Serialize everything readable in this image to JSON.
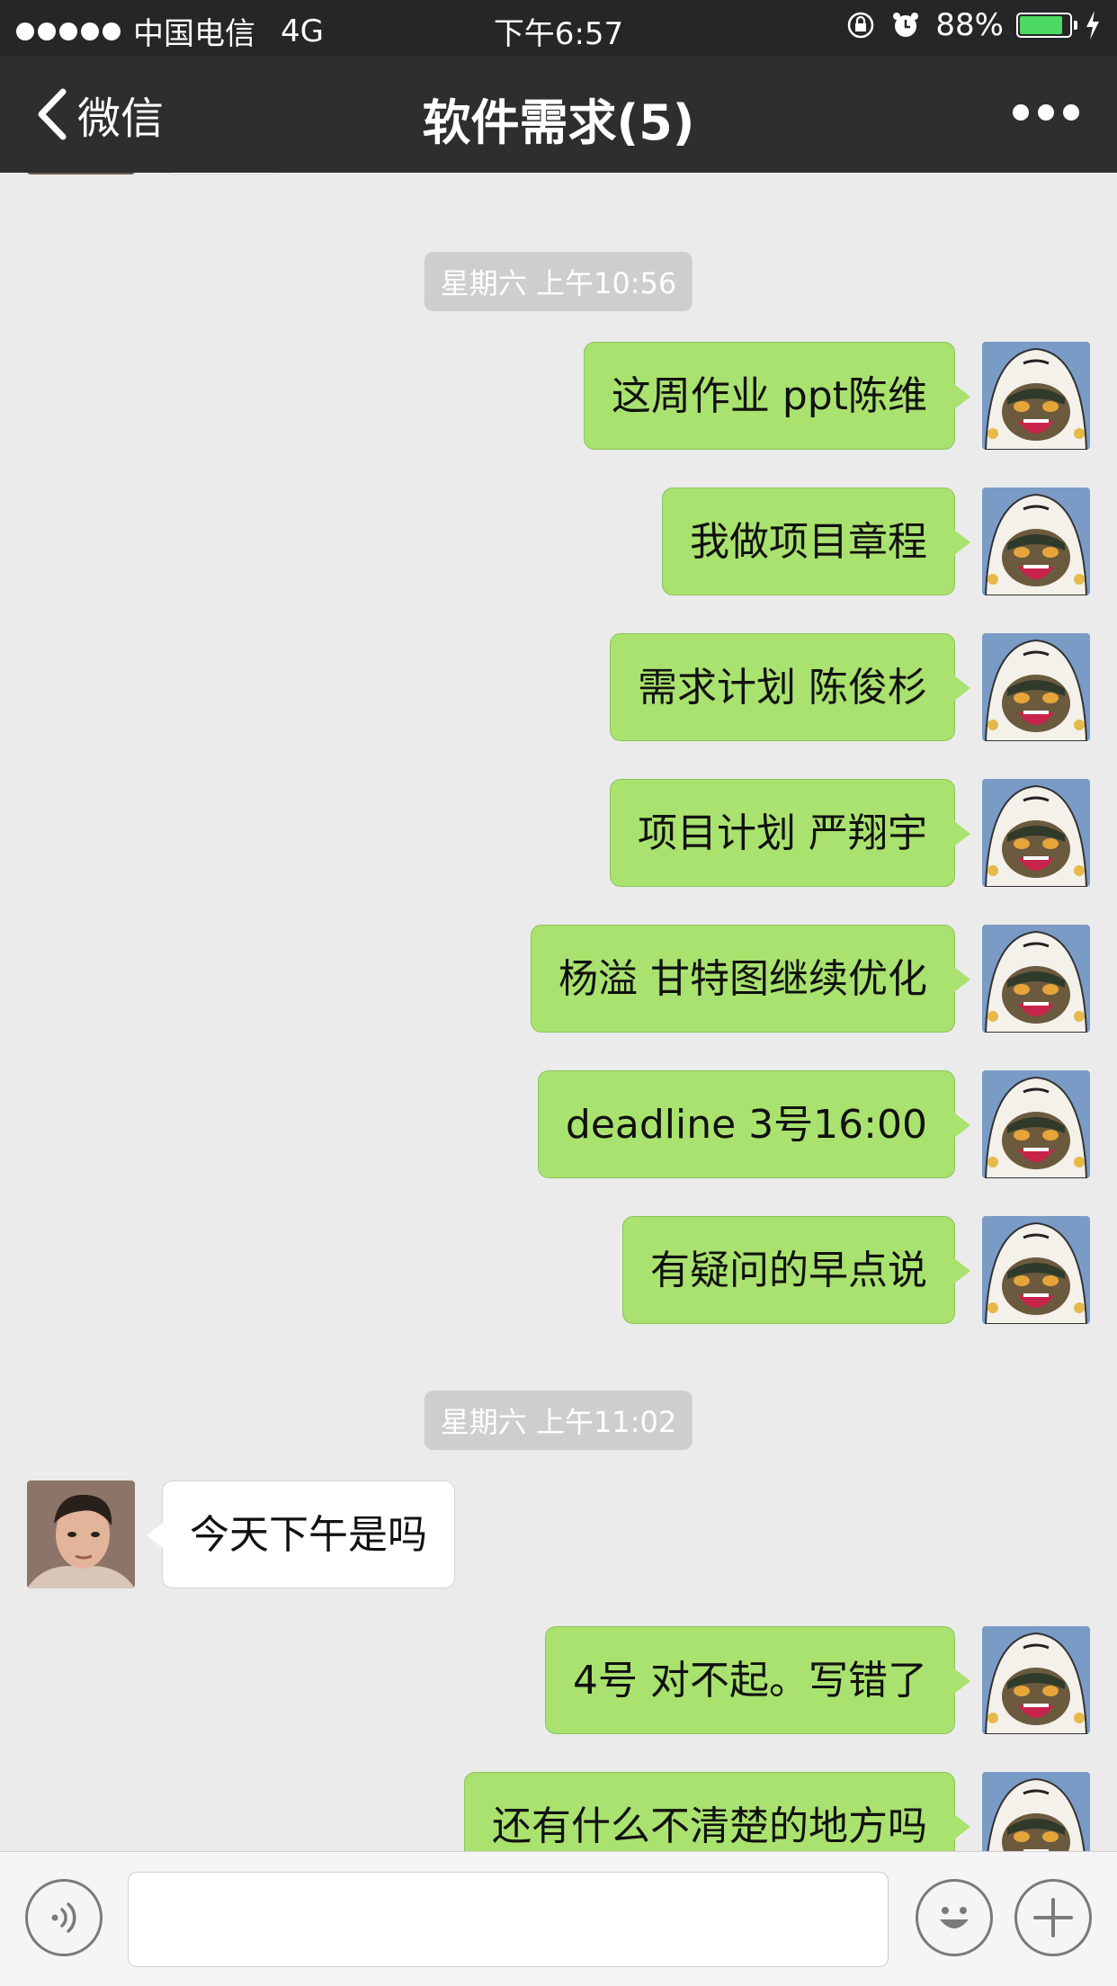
{
  "status_bar": {
    "carrier": "中国电信",
    "network": "4G",
    "time": "下午6:57",
    "battery_percent": "88%",
    "battery_level": 0.88
  },
  "nav": {
    "back_label": "微信",
    "title": "软件需求(5)"
  },
  "messages": [
    {
      "side": "sent",
      "text": "这周作业 ppt陈维"
    },
    {
      "side": "sent",
      "text": "我做项目章程"
    },
    {
      "side": "sent",
      "text": "需求计划 陈俊杉"
    },
    {
      "side": "sent",
      "text": "项目计划 严翔宇"
    },
    {
      "side": "sent",
      "text": "杨溢 甘特图继续优化"
    },
    {
      "side": "sent",
      "text": "deadline 3号16:00"
    },
    {
      "side": "sent",
      "text": "有疑问的早点说"
    },
    {
      "side": "recv",
      "text": "今天下午是吗"
    },
    {
      "side": "sent",
      "text": "4号 对不起。写错了"
    },
    {
      "side": "sent",
      "text": "还有什么不清楚的地方吗"
    }
  ],
  "timestamps": [
    "星期六 上午10:56",
    "星期六 上午11:02"
  ],
  "colors": {
    "sent_bubble": "#a9e26e",
    "recv_bubble": "#ffffff",
    "nav_bg": "#2e2e31",
    "chat_bg": "#ebebeb"
  },
  "input_bar": {
    "placeholder": ""
  }
}
